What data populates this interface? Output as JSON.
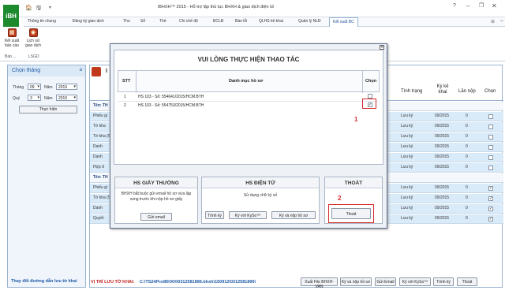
{
  "app": {
    "logo": "iBH",
    "title": "iBHXH™ 2015 - Hỗ trợ lập thủ tục BHXH & giao dịch điện tử"
  },
  "titlebar": {
    "quick1": "🏠",
    "quick2": "🖫"
  },
  "tabs": [
    "Thông tin chung",
    "Đăng ký giao dịch",
    "Thu",
    "Sổ",
    "Thẻ",
    "Chi chế độ",
    "BCLĐ",
    "Báo lỗi",
    "QLHS kê khai",
    "Quản lý NLĐ",
    "Kết xuất BC"
  ],
  "ribbon": {
    "btn1": "Kết xuất báo cáo",
    "btn2": "Lịch sử giao dịch",
    "group1": "Báo ...",
    "group2": "LSGD"
  },
  "left": {
    "header": "Chọn tháng",
    "arrow": "a",
    "thang_label": "Tháng",
    "thang_val": "09",
    "nam_label": "Năm",
    "nam_val": "2015",
    "quy_label": "Quý",
    "quy_val": "3",
    "nam2_val": "2015",
    "run_btn": "Thực hiện",
    "footer": "Thay đổi đường dẫn lưu tờ khai"
  },
  "table": {
    "headers": [
      "Tình trạng",
      "Kỳ kê khai",
      "Lần nộp",
      "Chọn"
    ],
    "rows": [
      {
        "left": "Tên: TH",
        "c1": "",
        "c2": "",
        "c3": "",
        "chk": "",
        "group": true
      },
      {
        "left": "Phiếu gi",
        "c1": "Lưu ký",
        "c2": "09/2015",
        "c3": "0",
        "chk": ""
      },
      {
        "left": "Tờ kha",
        "c1": "Lưu ký",
        "c2": "09/2015",
        "c3": "0",
        "chk": ""
      },
      {
        "left": "Tờ kha (55464",
        "c1": "Lưu ký",
        "c2": "09/2015",
        "c3": "0",
        "chk": ""
      },
      {
        "left": "Danh",
        "c1": "Lưu ký",
        "c2": "09/2015",
        "c3": "0",
        "chk": ""
      },
      {
        "left": "Danh",
        "c1": "Lưu ký",
        "c2": "09/2015",
        "c3": "0",
        "chk": ""
      },
      {
        "left": "Hợp đ",
        "c1": "Lưu ký",
        "c2": "09/2015",
        "c3": "0",
        "chk": ""
      },
      {
        "left": "Tên: TH",
        "c1": "",
        "c2": "",
        "c3": "",
        "chk": "",
        "group": true
      },
      {
        "left": "Phiếu gi",
        "c1": "Lưu ký",
        "c2": "09/2015",
        "c3": "0",
        "chk": "✓"
      },
      {
        "left": "Tờ kha (55475",
        "c1": "Lưu ký",
        "c2": "09/2015",
        "c3": "0",
        "chk": "✓"
      },
      {
        "left": "Danh",
        "c1": "Lưu ký",
        "c2": "09/2015",
        "c3": "0",
        "chk": "✓"
      },
      {
        "left": "Quyết",
        "c1": "Lưu ký",
        "c2": "09/2015",
        "c3": "0",
        "chk": "✓"
      }
    ]
  },
  "status": {
    "label": "VỊ TRÍ LƯU TỜ KHAI:",
    "path": "C:\\TS24Pro\\BHXH\\0312581896.bhxh\\150912\\0312581896\\"
  },
  "bottom_buttons": [
    "Xuất File BHXH-VAN",
    "Ký và nộp hồ sơ",
    "Gửi Email",
    "Ký với KySo™",
    "Trình ký",
    "Thoát"
  ],
  "dialog": {
    "title": "VUI LÒNG THỰC HIỆN THAO TÁC",
    "col_stt": "STT",
    "col_danhmuc": "Danh mục hồ sơ",
    "col_chon": "Chọn",
    "rows": [
      {
        "stt": "1",
        "name": "HS 103 - Số: 554641/2015/HCM.BTH",
        "chk": ""
      },
      {
        "stt": "2",
        "name": "HS 103 - Số: 554753/2015/HCM.BTH",
        "chk": "✓"
      }
    ],
    "panel1": {
      "title": "HS GIẤY THƯỜNG",
      "desc": "BHXH bắt buộc gửi email hồ sơ vừa lập xong trước khi nộp hồ sơ giấy",
      "btn": "Gửi email"
    },
    "panel2": {
      "title": "HS ĐIỆN TỬ",
      "desc": "Sử dụng chữ ký số",
      "btn1": "Trình ký",
      "btn2": "Ký với KySo™",
      "btn3": "Ký và nộp hồ sơ"
    },
    "panel3": {
      "title": "THOÁT",
      "btn": "Thoát"
    },
    "anno1": "1",
    "anno2": "2"
  }
}
